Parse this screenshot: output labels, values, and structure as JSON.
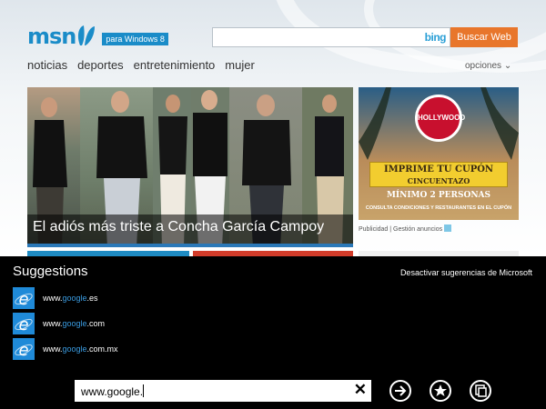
{
  "header": {
    "logo": "msn",
    "edition_badge": "para Windows 8",
    "search": {
      "value": "",
      "placeholder": "",
      "engine_logo": "bing",
      "button_label": "Buscar Web"
    }
  },
  "nav": {
    "items": [
      "noticias",
      "deportes",
      "entretenimiento",
      "mujer"
    ],
    "options_label": "opciones"
  },
  "feature": {
    "caption": "El adiós más triste a Concha García Campoy"
  },
  "ad": {
    "brand": "HOLLYWOOD",
    "headline": "IMPRIME TU CUPÓN",
    "subheadline": "CINCUENTAZO",
    "minimum": "MÍNIMO 2 PERSONAS",
    "terms": "CONSULTA CONDICIONES Y RESTAURANTES EN EL CUPÓN",
    "footer": "Publicidad | Gestión anuncios"
  },
  "suggestions": {
    "title": "Suggestions",
    "disable_label": "Desactivar sugerencias de Microsoft",
    "items": [
      {
        "prefix": "www.",
        "match": "google",
        "suffix": ".es"
      },
      {
        "prefix": "www.",
        "match": "google",
        "suffix": ".com"
      },
      {
        "prefix": "www.",
        "match": "google",
        "suffix": ".com.mx"
      }
    ]
  },
  "address_bar": {
    "value": "www.google."
  },
  "colors": {
    "msn_blue": "#1a8cc8",
    "search_button": "#e8762b",
    "ie_icon": "#1f8ad8",
    "highlight_text": "#3a9be0",
    "panel_bg": "#000000"
  },
  "icons": {
    "clear": "close-icon",
    "go": "arrow-right-icon",
    "favorite": "star-icon",
    "tabs": "tabs-icon"
  }
}
